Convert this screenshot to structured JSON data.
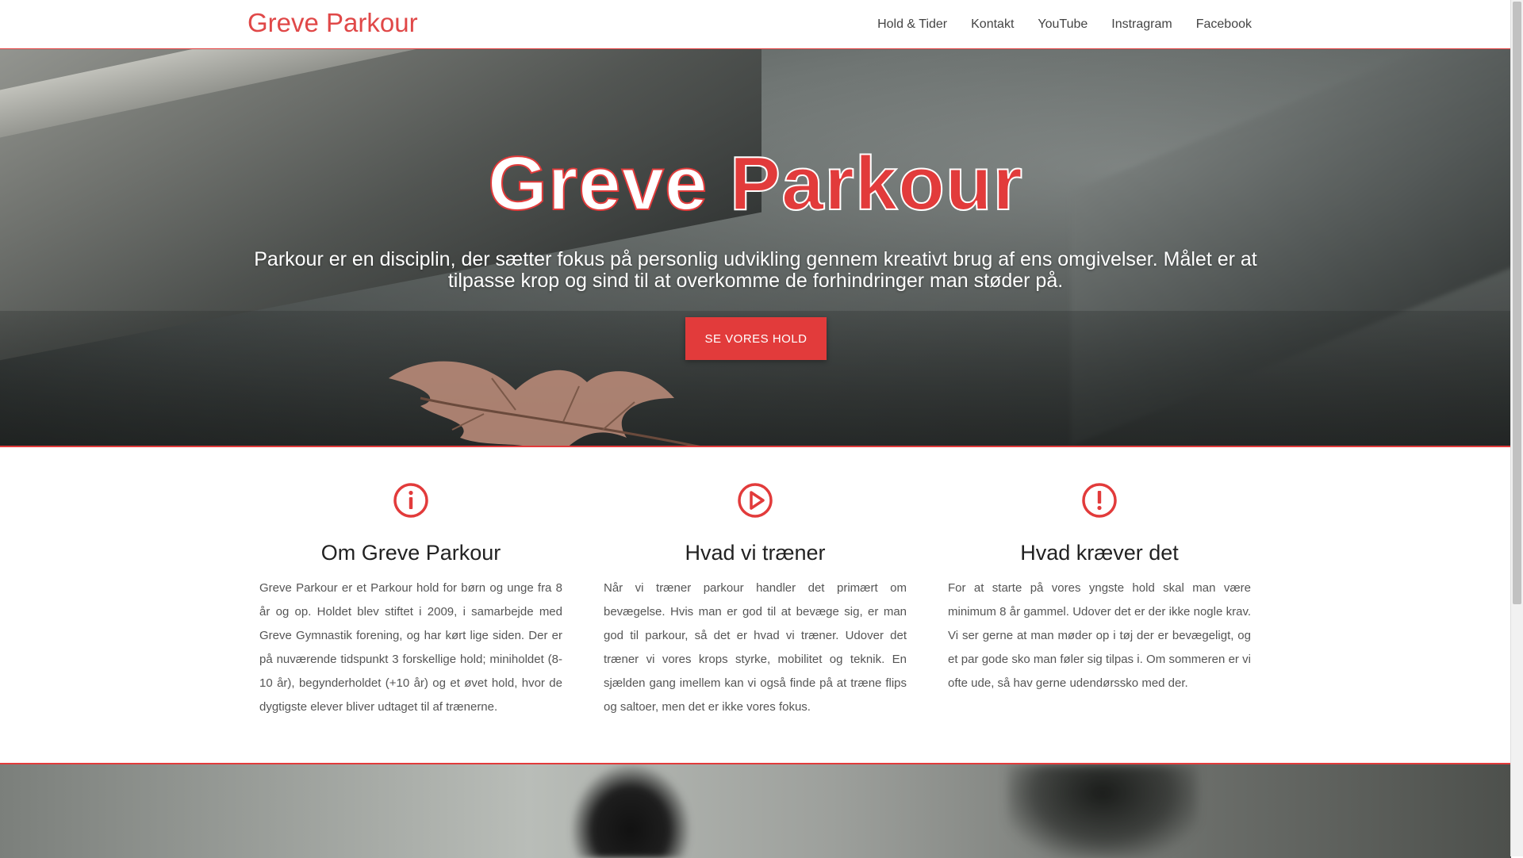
{
  "navbar": {
    "brand": "Greve Parkour",
    "links": [
      "Hold & Tider",
      "Kontakt",
      "YouTube",
      "Instragram",
      "Facebook"
    ]
  },
  "hero": {
    "title_word1": "Greve",
    "title_word2": "Parkour",
    "text": "Parkour er en disciplin, der sætter fokus på personlig udvikling gennem kreativt brug af ens omgivelser. Målet er at tilpasse krop og sind til at overkomme de forhindringer man støder på.",
    "button_label": "SE VORES HOLD"
  },
  "features": [
    {
      "icon": "info-circle-icon",
      "title": "Om Greve Parkour",
      "text": "Greve Parkour er et Parkour hold for børn og unge fra 8 år og op. Holdet blev stiftet i 2009, i samarbejde med Greve Gymnastik forening, og har kørt lige siden. Der er på nuværende tidspunkt 3 forskellige hold; miniholdet (8-10 år), begynderholdet (+10 år) og et øvet hold, hvor de dygtigste elever bliver udtaget til af trænerne."
    },
    {
      "icon": "play-circle-icon",
      "title": "Hvad vi træner",
      "text": "Når vi træner parkour handler det primært om bevægelse. Hvis man er god til at bevæge sig, er man god til parkour, så det er hvad vi træner. Udover det træner vi vores krops styrke, mobilitet og teknik. En sjælden gang imellem kan vi også finde på at træne flips og saltoer, men det er ikke vores fokus."
    },
    {
      "icon": "exclamation-circle-icon",
      "title": "Hvad kræver det",
      "text": "For at starte på vores yngste hold skal man være minimum 8 år gammel. Udover det er der ikke nogle krav. Vi ser gerne at man møder op i tøj der er bevægeligt, og et par gode sko man føler sig tilpas i. Om sommeren er vi ofte ude, så hav gerne udendørssko med der."
    }
  ],
  "colors": {
    "accent": "#e23b3b",
    "brand": "#e04848"
  }
}
